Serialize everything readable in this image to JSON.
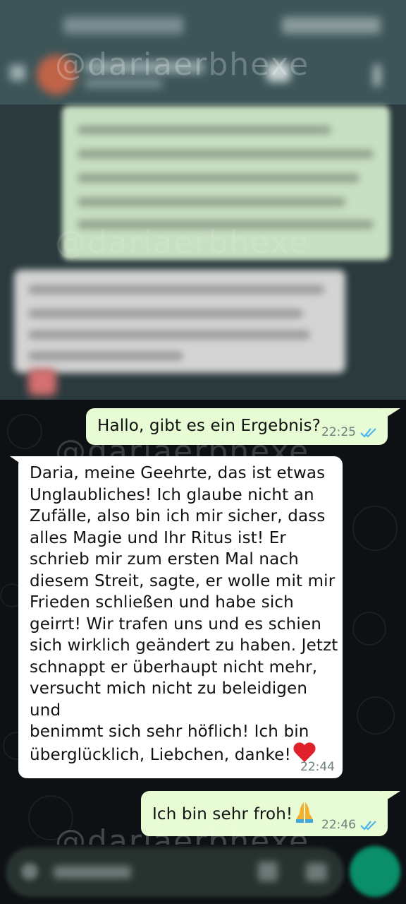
{
  "watermark": "@dariaerbhexe",
  "messages": [
    {
      "direction": "outgoing",
      "text": "Hallo, gibt es ein Ergebnis?",
      "time": "22:25",
      "status": "read"
    },
    {
      "direction": "incoming",
      "lines": [
        "Daria, meine Geehrte, das ist etwas",
        "Unglaubliches! Ich glaube nicht an",
        "Zufälle, also bin ich mir sicher, dass",
        "alles Magie und Ihr Ritus ist! Er",
        "schrieb mir zum ersten Mal nach",
        "diesem Streit, sagte, er wolle mit mir",
        "Frieden schließen und habe sich",
        "geirrt! Wir trafen uns und es schien",
        "sich wirklich geändert zu haben. Jetzt",
        "schnappt er überhaupt nicht mehr,",
        "versucht mich nicht zu beleidigen und",
        "benimmt sich sehr höflich! Ich bin",
        "überglücklich, Liebchen, danke!"
      ],
      "emoji": "red-heart",
      "time": "22:44"
    },
    {
      "direction": "outgoing",
      "text": "Ich bin sehr froh!",
      "emoji": "folded-hands",
      "time": "22:46",
      "status": "read"
    }
  ],
  "colors": {
    "outgoing_bubble": "#e7fbd5",
    "incoming_bubble": "#ffffff",
    "read_ticks": "#4fb6ec",
    "chat_background": "#0e1114",
    "send_button": "#0a8f6a"
  }
}
